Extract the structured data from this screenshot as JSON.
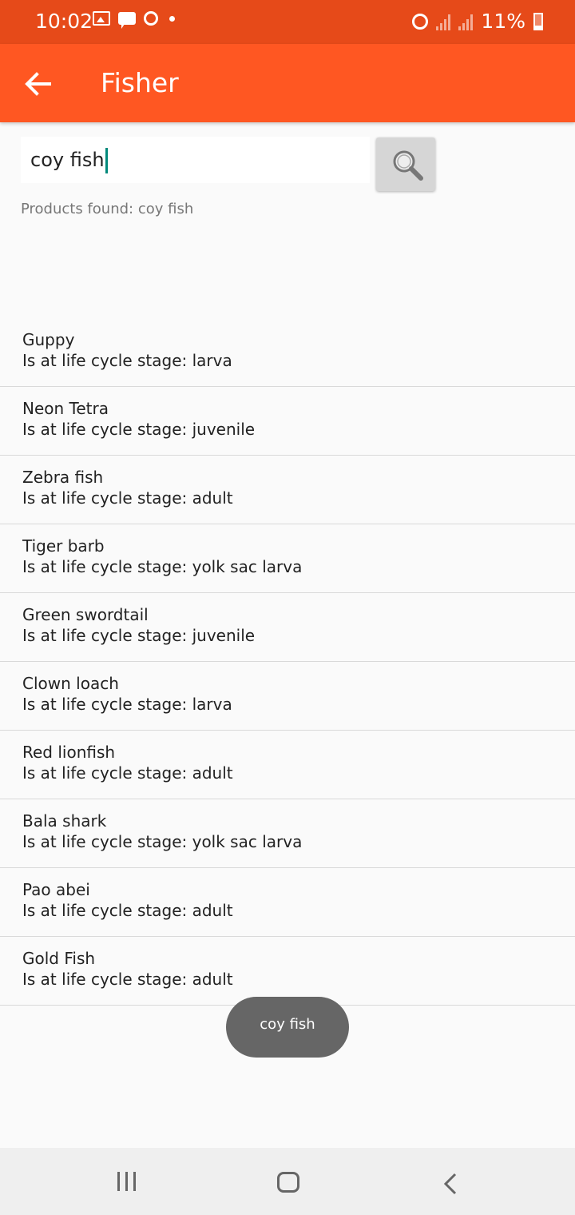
{
  "status_bar": {
    "time": "10:02",
    "battery": "11%"
  },
  "app_bar": {
    "title": "Fisher",
    "back_icon": "arrow-left-icon",
    "background": "#ff5722"
  },
  "search": {
    "value": "coy fish",
    "button_icon": "search-icon"
  },
  "results_label": "Products found: coy fish",
  "products": [
    {
      "name": "Guppy",
      "stage": "Is at life cycle stage: larva"
    },
    {
      "name": "Neon Tetra",
      "stage": "Is at life cycle stage: juvenile"
    },
    {
      "name": "Zebra fish",
      "stage": "Is at life cycle stage: adult"
    },
    {
      "name": "Tiger barb",
      "stage": "Is at life cycle stage: yolk sac larva"
    },
    {
      "name": "Green swordtail",
      "stage": "Is at life cycle stage: juvenile"
    },
    {
      "name": "Clown loach",
      "stage": "Is at life cycle stage: larva"
    },
    {
      "name": "Red lionfish",
      "stage": "Is at life cycle stage: adult"
    },
    {
      "name": "Bala shark",
      "stage": "Is at life cycle stage: yolk sac larva"
    },
    {
      "name": "Pao abei",
      "stage": "Is at life cycle stage: adult"
    },
    {
      "name": "Gold Fish",
      "stage": "Is at life cycle stage: adult"
    }
  ],
  "toast": "coy fish"
}
